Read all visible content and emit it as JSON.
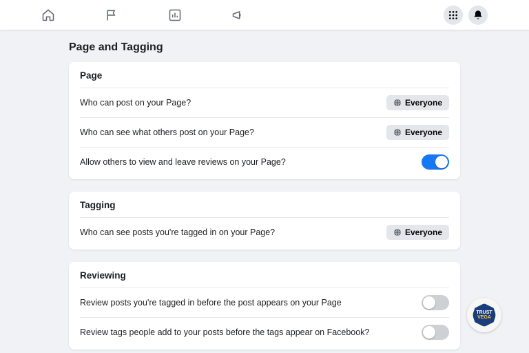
{
  "header": {
    "title": "Page and Tagging"
  },
  "sections": {
    "page": {
      "title": "Page",
      "rows": [
        {
          "label": "Who can post on your Page?",
          "audience": "Everyone"
        },
        {
          "label": "Who can see what others post on your Page?",
          "audience": "Everyone"
        },
        {
          "label": "Allow others to view and leave reviews on your Page?"
        }
      ]
    },
    "tagging": {
      "title": "Tagging",
      "rows": [
        {
          "label": "Who can see posts you're tagged in on your Page?",
          "audience": "Everyone"
        }
      ]
    },
    "reviewing": {
      "title": "Reviewing",
      "rows": [
        {
          "label": "Review posts you're tagged in before the post appears on your Page"
        },
        {
          "label": "Review tags people add to your posts before the tags appear on Facebook?"
        }
      ]
    }
  },
  "badge": {
    "line1": "TRUST",
    "line2": "VEGA"
  }
}
